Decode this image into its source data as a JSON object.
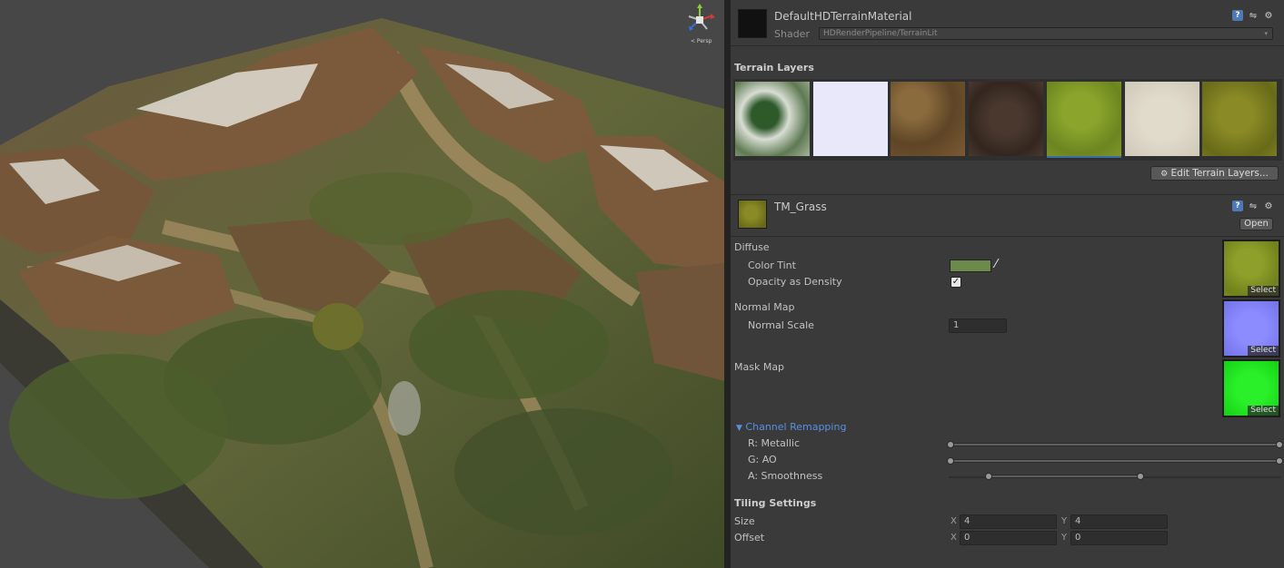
{
  "scene": {
    "gizmo_label": "< Persp",
    "gizmo_icon": "scene-orientation-gizmo-icon"
  },
  "material": {
    "name": "DefaultHDTerrainMaterial",
    "shader_label": "Shader",
    "shader_value": "HDRenderPipeline/TerrainLit"
  },
  "terrain_layers": {
    "title": "Terrain Layers",
    "thumbnails": [
      {
        "name": "snow-rock",
        "color": "#6f8a66"
      },
      {
        "name": "blank",
        "color": "#e8e8fa"
      },
      {
        "name": "dirt",
        "color": "#6a4f2c"
      },
      {
        "name": "dark-soil",
        "color": "#3e2e26"
      },
      {
        "name": "grass-bright",
        "color": "#7b9226"
      },
      {
        "name": "sand",
        "color": "#d8d2c2"
      },
      {
        "name": "grass",
        "color": "#777a20"
      }
    ],
    "selected_index": 4,
    "edit_button": "Edit Terrain Layers..."
  },
  "layer": {
    "name": "TM_Grass",
    "open_button": "Open",
    "diffuse_label": "Diffuse",
    "color_tint_label": "Color Tint",
    "color_tint_value": "#6c8a4c",
    "opacity_density_label": "Opacity as Density",
    "opacity_density_checked": true,
    "normal_map_label": "Normal Map",
    "normal_scale_label": "Normal Scale",
    "normal_scale_value": "1",
    "mask_map_label": "Mask Map",
    "select_label": "Select",
    "channel_remapping_label": "Channel Remapping",
    "channels": [
      {
        "label": "R: Metallic",
        "min": 0.0,
        "max": 1.0
      },
      {
        "label": "G: AO",
        "min": 0.0,
        "max": 1.0
      },
      {
        "label": "A: Smoothness",
        "min": 0.12,
        "max": 0.58
      }
    ],
    "tiling_title": "Tiling Settings",
    "size_label": "Size",
    "offset_label": "Offset",
    "size_x": "4",
    "size_y": "4",
    "offset_x": "0",
    "offset_y": "0",
    "axis_x": "X",
    "axis_y": "Y"
  },
  "colors": {
    "diffuse_tex": "#7a8a1e",
    "normal_tex": "#7d7df5",
    "mask_tex": "#1ee01e",
    "accent": "#5b8fe0"
  }
}
